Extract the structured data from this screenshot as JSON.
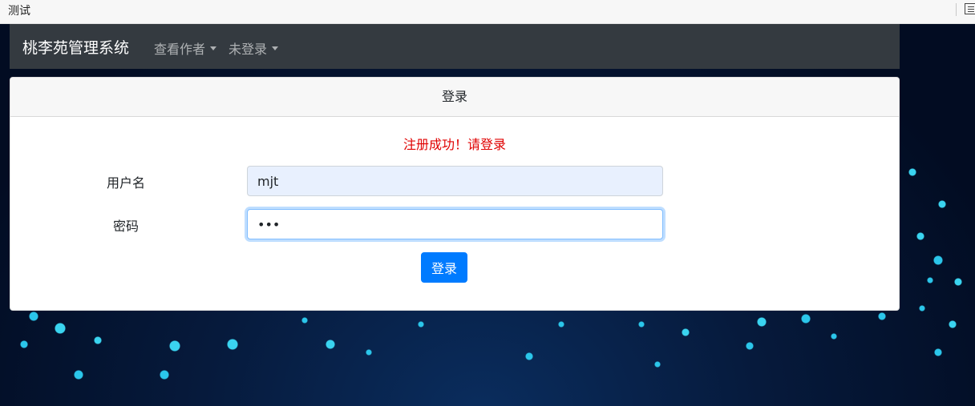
{
  "tab": {
    "title": "测试",
    "icon": "reader-mode-icon"
  },
  "navbar": {
    "brand": "桃李苑管理系统",
    "items": [
      {
        "label": "查看作者",
        "icon": "caret-down-icon"
      },
      {
        "label": "未登录",
        "icon": "caret-down-icon"
      }
    ],
    "bg_color": "#343a40"
  },
  "card": {
    "header": "登录",
    "message": "注册成功！请登录",
    "message_color": "#e00000",
    "username_label": "用户名",
    "username_value": "mjt",
    "password_label": "密码",
    "password_value": "•••",
    "submit_label": "登录",
    "submit_color": "#007bff"
  }
}
